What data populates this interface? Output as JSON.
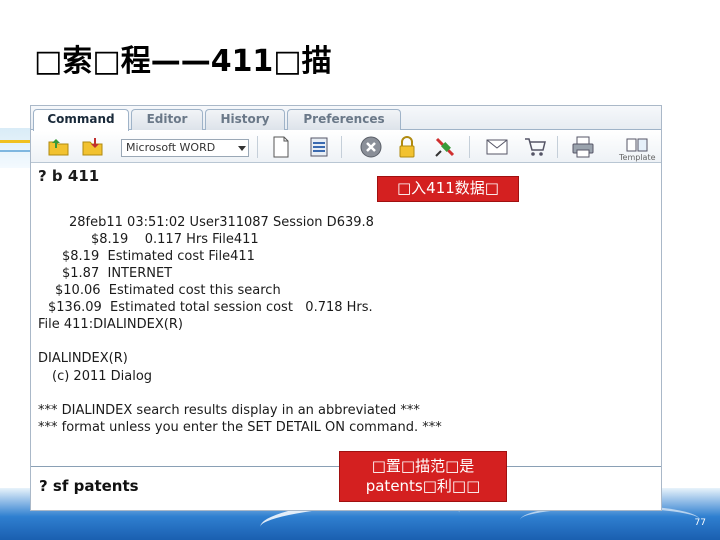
{
  "slide": {
    "title": "□索□程——411□描",
    "page_number": "77"
  },
  "tabs": [
    {
      "label": "Command",
      "active": true
    },
    {
      "label": "Editor",
      "active": false
    },
    {
      "label": "History",
      "active": false
    },
    {
      "label": "Preferences",
      "active": false
    }
  ],
  "toolbar": {
    "font_value": "Microsoft WORD",
    "template_label": "Template"
  },
  "output": {
    "command": "? b 411",
    "lines": [
      "28feb11 03:51:02 User311087 Session D639.8",
      "$8.19    0.117 Hrs File411",
      "$8.19  Estimated cost File411",
      "$1.87  INTERNET",
      "$10.06  Estimated cost this search",
      "$136.09  Estimated total session cost   0.718 Hrs.",
      "File 411:DIALINDEX(R)",
      "DIALINDEX(R)",
      "(c) 2011 Dialog",
      "*** DIALINDEX search results display in an abbreviated ***",
      "*** format unless you enter the SET DETAIL ON command. ***"
    ]
  },
  "input": {
    "command": "? sf patents"
  },
  "callouts": {
    "first": "□入411数据□",
    "second_line1": "□置□描范□是",
    "second_line2": "patents□利□□"
  },
  "colors": {
    "callout_red": "#d42020",
    "tab_border": "#9fb3c8"
  }
}
